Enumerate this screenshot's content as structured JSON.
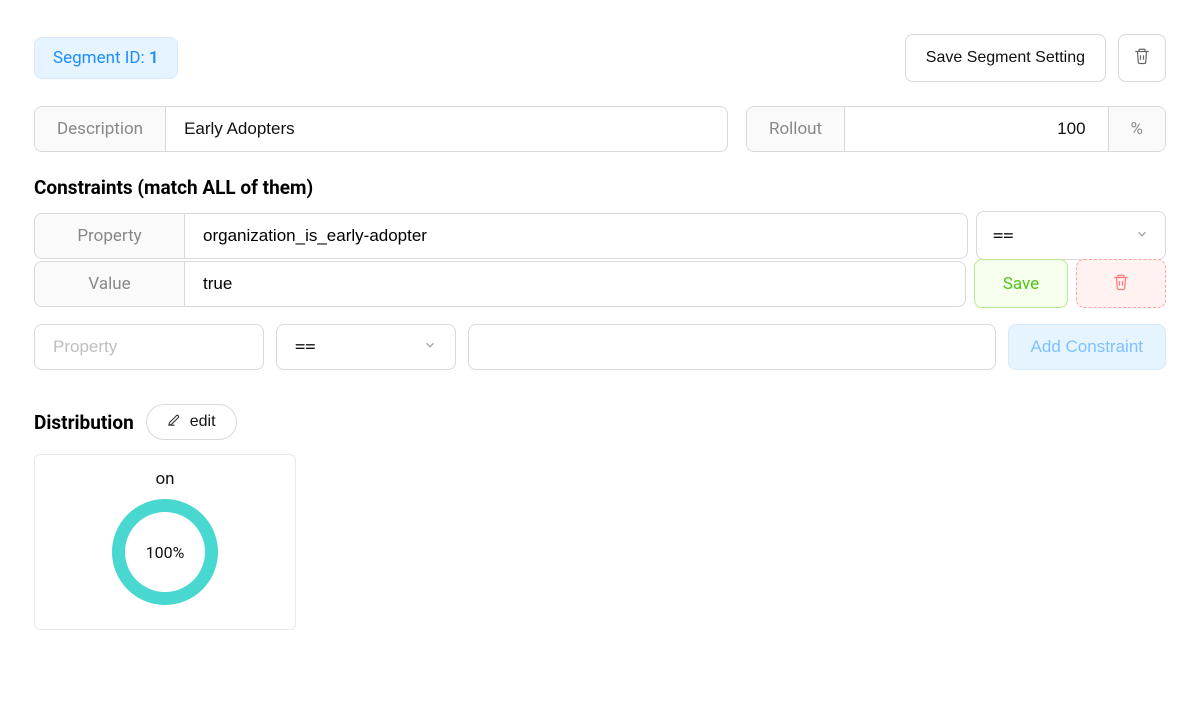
{
  "header": {
    "segment_prefix": "Segment ID: ",
    "segment_number": "1",
    "save_button": "Save Segment Setting"
  },
  "form": {
    "description_label": "Description",
    "description_value": "Early Adopters",
    "rollout_label": "Rollout",
    "rollout_value": "100",
    "rollout_suffix": "%"
  },
  "constraints": {
    "heading": "Constraints (match ALL of them)",
    "property_label": "Property",
    "value_label": "Value",
    "existing": {
      "property": "organization_is_early-adopter",
      "operator": "==",
      "value": "true",
      "save_label": "Save"
    },
    "new": {
      "property_placeholder": "Property",
      "operator": "==",
      "add_label": "Add Constraint"
    }
  },
  "distribution": {
    "heading": "Distribution",
    "edit_label": "edit",
    "variant_label": "on",
    "percent_text": "100%"
  },
  "chart_data": {
    "type": "pie",
    "title": "on",
    "categories": [
      "on"
    ],
    "values": [
      100
    ],
    "colors": [
      "#48d8cf"
    ]
  }
}
